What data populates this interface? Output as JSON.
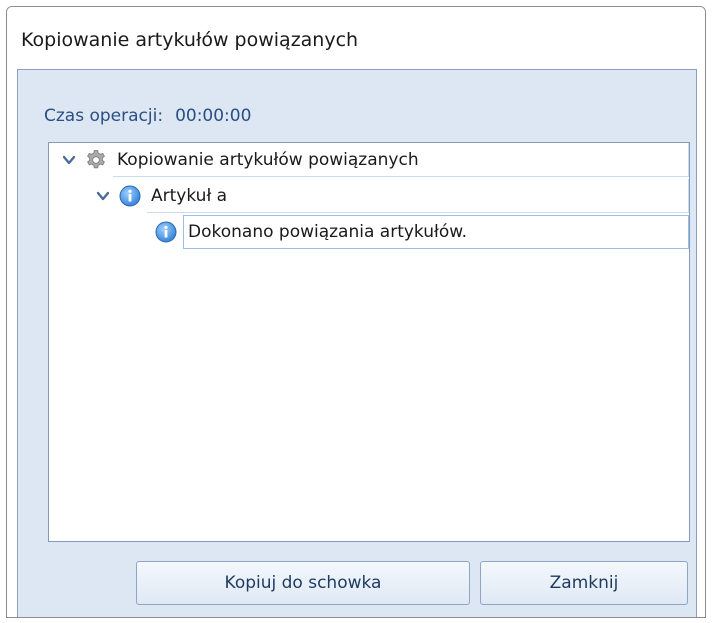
{
  "window": {
    "title": "Kopiowanie artykułów powiązanych"
  },
  "operation_time": {
    "label": "Czas operacji:",
    "value": "00:00:00"
  },
  "tree": {
    "root": {
      "label": "Kopiowanie artykułów powiązanych",
      "icon": "gear-icon"
    },
    "child": {
      "label": "Artykuł a",
      "icon": "info-icon"
    },
    "grandchild": {
      "label": "Dokonano powiązania artykułów.",
      "icon": "info-icon"
    }
  },
  "buttons": {
    "copy_label": "Kopiuj do schowka",
    "close_label": "Zamknij"
  },
  "colors": {
    "accent": "#2a4f82",
    "panel": "#dde6f3",
    "info": "#3d8ee0"
  }
}
